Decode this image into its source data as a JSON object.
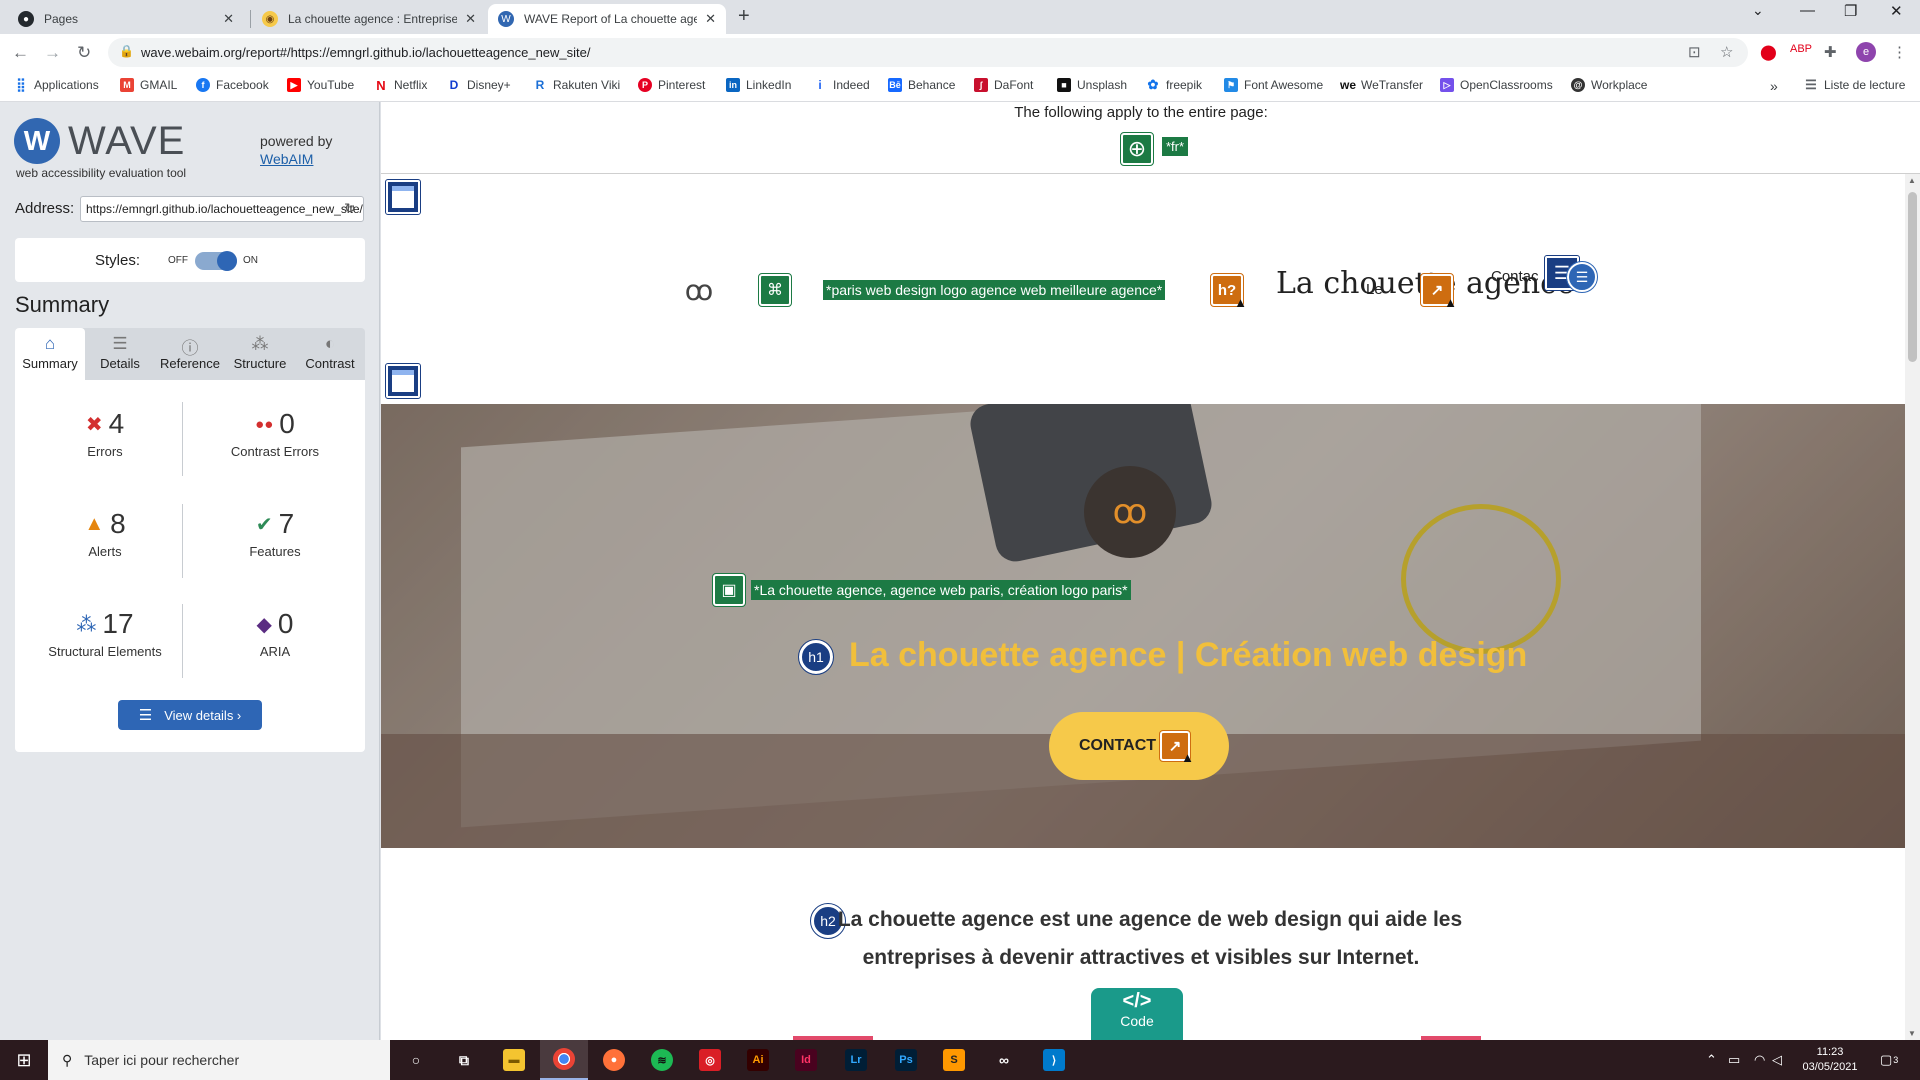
{
  "browser": {
    "tabs": [
      {
        "title": "Pages",
        "favicon": "github-icon"
      },
      {
        "title": "La chouette agence : Entreprise w",
        "favicon": "owl-icon"
      },
      {
        "title": "WAVE Report of La chouette agen",
        "favicon": "wave-icon"
      }
    ],
    "url": "wave.webaim.org/report#/https://emngrl.github.io/lachouetteagence_new_site/",
    "bookmarks": [
      {
        "label": "Applications",
        "icon": "apps-grid-icon",
        "color": "#1a73e8"
      },
      {
        "label": "GMAIL",
        "icon": "gmail-icon",
        "color": "#ea4335"
      },
      {
        "label": "Facebook",
        "icon": "facebook-icon",
        "color": "#1877f2"
      },
      {
        "label": "YouTube",
        "icon": "youtube-icon",
        "color": "#ff0000"
      },
      {
        "label": "Netflix",
        "icon": "netflix-icon",
        "color": "#e50914"
      },
      {
        "label": "Disney+",
        "icon": "disney-icon",
        "color": "#113ccf"
      },
      {
        "label": "Rakuten Viki",
        "icon": "rakuten-icon",
        "color": "#1b6fd6"
      },
      {
        "label": "Pinterest",
        "icon": "pinterest-icon",
        "color": "#e60023"
      },
      {
        "label": "LinkedIn",
        "icon": "linkedin-icon",
        "color": "#0a66c2"
      },
      {
        "label": "Indeed",
        "icon": "indeed-icon",
        "color": "#2164f3"
      },
      {
        "label": "Behance",
        "icon": "behance-icon",
        "color": "#1769ff"
      },
      {
        "label": "DaFont",
        "icon": "dafont-icon",
        "color": "#c8102e"
      },
      {
        "label": "Unsplash",
        "icon": "unsplash-icon",
        "color": "#111111"
      },
      {
        "label": "freepik",
        "icon": "freepik-icon",
        "color": "#1273eb"
      },
      {
        "label": "Font Awesome",
        "icon": "fontawesome-icon",
        "color": "#228ae6"
      },
      {
        "label": "WeTransfer",
        "icon": "wetransfer-icon",
        "color": "#111111"
      },
      {
        "label": "OpenClassrooms",
        "icon": "openclassrooms-icon",
        "color": "#7451eb"
      },
      {
        "label": "Workplace",
        "icon": "workplace-icon",
        "color": "#333333"
      }
    ],
    "bookmarks_overflow": "»",
    "reading_list": "Liste de lecture"
  },
  "wave": {
    "brand": "WAVE",
    "tagline": "web accessibility evaluation tool",
    "powered_by": "powered by",
    "powered_link": "WebAIM",
    "address_label": "Address:",
    "address_value": "https://emngrl.github.io/lachouetteagence_new_site/",
    "styles_label": "Styles:",
    "styles_off": "OFF",
    "styles_on": "ON",
    "summary_heading": "Summary",
    "tabs": [
      "Summary",
      "Details",
      "Reference",
      "Structure",
      "Contrast"
    ],
    "stats": {
      "errors": {
        "count": "4",
        "label": "Errors"
      },
      "contrast_errors": {
        "count": "0",
        "label": "Contrast Errors"
      },
      "alerts": {
        "count": "8",
        "label": "Alerts"
      },
      "features": {
        "count": "7",
        "label": "Features"
      },
      "structural": {
        "count": "17",
        "label": "Structural Elements"
      },
      "aria": {
        "count": "0",
        "label": "ARIA"
      }
    },
    "view_details": "View details ›",
    "colors": {
      "primary": "#2e66b5",
      "error": "#d32f2f",
      "alert": "#e5860f",
      "feature": "#2e8b57"
    }
  },
  "preview": {
    "apply_text": "The following apply to the entire page:",
    "lang_tag": "*fr*",
    "logo_alt": "*paris web design logo agence web meilleure agence*",
    "alert_label": "h?",
    "nav_logo_text": "La chouette agence",
    "nav_link_1": "Le",
    "nav_link_2": "Contac",
    "image_alt": "*La chouette agence, agence web paris, création logo paris*",
    "h1_badge": "h1",
    "h1_text": "La chouette agence | Création web design",
    "cta": "CONTACT",
    "h2_badge": "h2",
    "h2_line1": "La chouette agence est une agence de web design qui aide les",
    "h2_line2": "entreprises à devenir attractives et visibles sur Internet.",
    "code_label": "Code",
    "code_symbol": "</>"
  },
  "taskbar": {
    "search_placeholder": "Taper ici pour rechercher",
    "apps": [
      "cortana",
      "task-view",
      "file-explorer",
      "chrome",
      "firefox",
      "spotify",
      "creative-cloud",
      "illustrator",
      "indesign",
      "lightroom",
      "photoshop",
      "sublime-text",
      "mask",
      "vscode"
    ],
    "time": "11:23",
    "date": "03/05/2021",
    "notifications": "3"
  }
}
